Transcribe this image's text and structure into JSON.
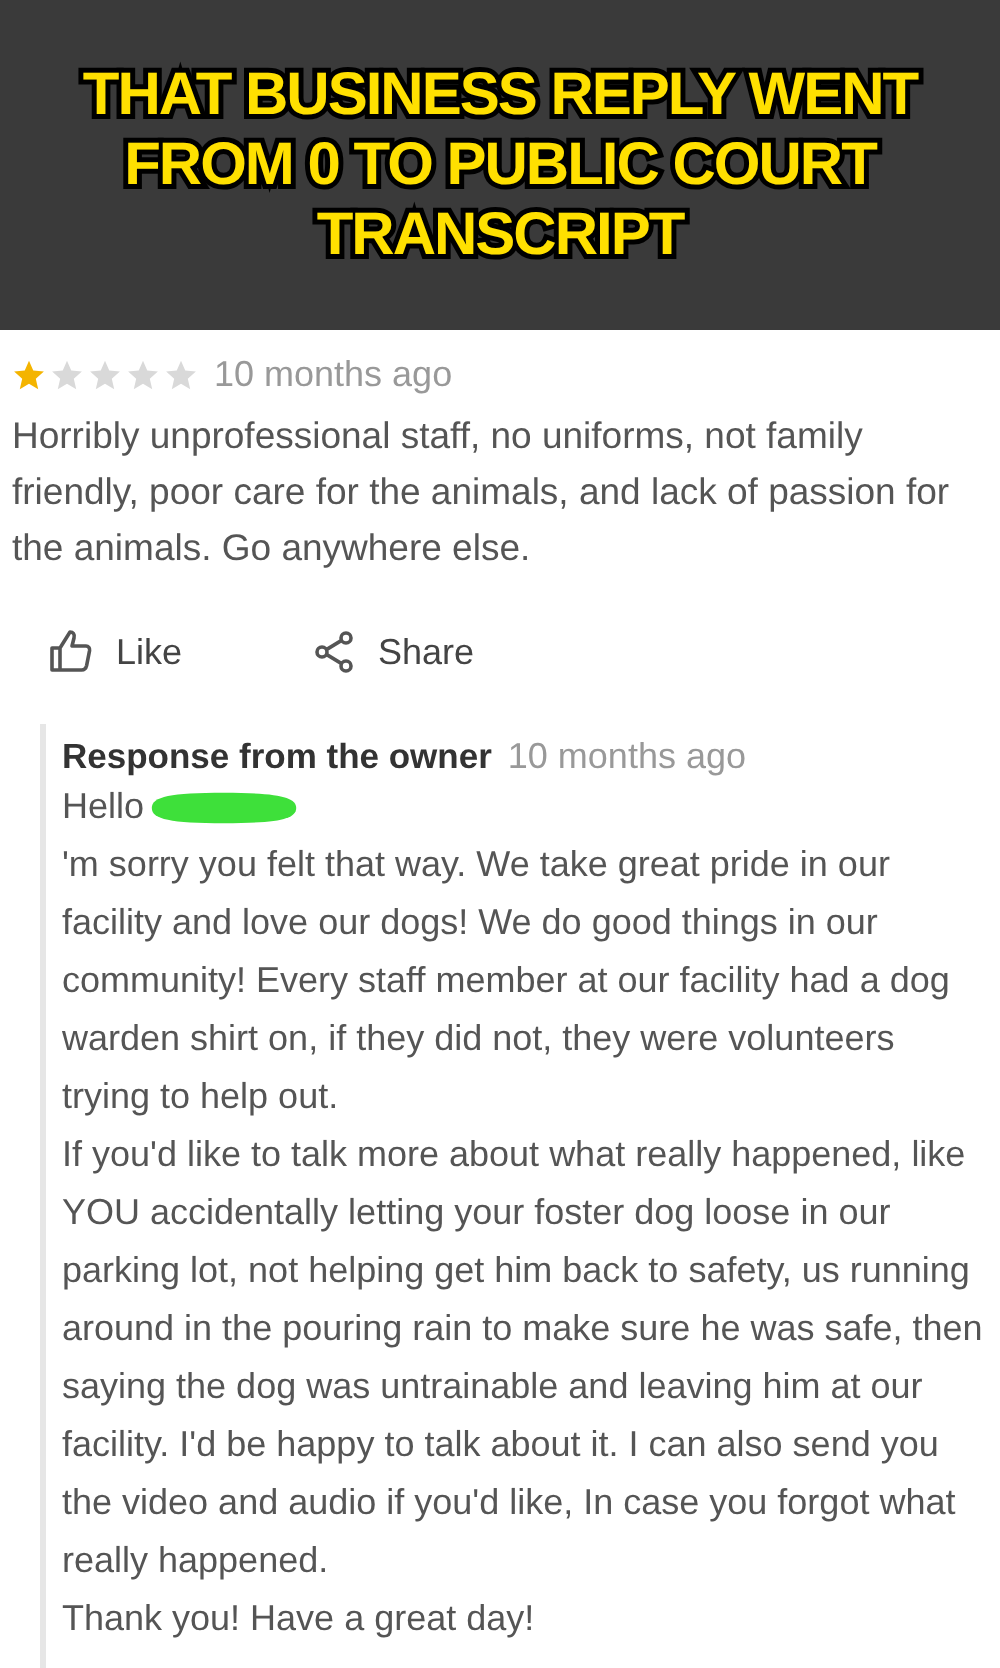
{
  "caption": "THAT BUSINESS REPLY WENT FROM 0 TO PUBLIC COURT TRANSCRIPT",
  "review": {
    "stars": 1,
    "time": "10 months ago",
    "text": "Horribly unprofessional staff, no uniforms, not family friendly, poor care for the animals, and lack of passion for the animals. Go anywhere else."
  },
  "actions": [
    {
      "kind": "like",
      "label": "Like"
    },
    {
      "kind": "share",
      "label": "Share"
    }
  ],
  "response": {
    "title": "Response from the owner",
    "time": "10 months ago",
    "greeting": "Hello",
    "first_paragraph": "'m sorry you felt that way. We take great pride in our facility and love our dogs! We do good things in our community! Every staff member at our facility had a dog warden shirt on, if they did not, they were volunteers trying to help out.",
    "paragraphs": [
      "If you'd like to talk more about what really happened, like YOU accidentally letting your foster dog loose in our parking lot, not helping get him back to safety, us running around in the pouring rain to make sure he was safe, then saying the dog was untrainable and leaving him at our facility. I'd be happy to talk about it. I can also send you the video and audio if you'd like, In case you forgot what really happened.",
      "Thank you! Have a great day!"
    ]
  }
}
